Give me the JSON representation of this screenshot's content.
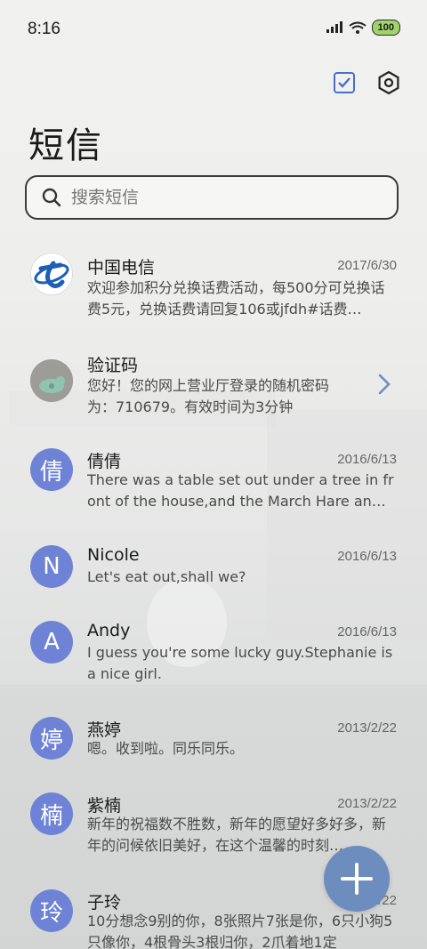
{
  "status_bar": {
    "time": "8:16",
    "battery": "100"
  },
  "header": {
    "title": "短信",
    "select_icon": "checkbox-icon",
    "settings_icon": "settings-icon"
  },
  "search": {
    "placeholder": "搜索短信"
  },
  "conversations": [
    {
      "name": "中国电信",
      "date": "2017/6/30",
      "preview": "欢迎参加积分兑换话费活动，每500分可兑换话费5元，兑换话费请回复106或jfdh#话费…",
      "avatar_type": "logo"
    },
    {
      "name": "验证码",
      "date": "",
      "preview": "您好！您的网上营业厅登录的随机密码为：710679。有效时间为3分钟",
      "avatar_type": "photo"
    },
    {
      "name": "倩倩",
      "date": "2016/6/13",
      "preview": "There was a table set out under a tree in front of the house,and the March Hare an…",
      "avatar_letter": "倩"
    },
    {
      "name": "Nicole",
      "date": "2016/6/13",
      "preview": "Let's eat out,shall we?",
      "avatar_letter": "N"
    },
    {
      "name": "Andy",
      "date": "2016/6/13",
      "preview": "I guess you're some lucky guy.Stephanie is a nice girl.",
      "avatar_letter": "A"
    },
    {
      "name": "燕婷",
      "date": "2013/2/22",
      "preview": "嗯。收到啦。同乐同乐。",
      "avatar_letter": "婷"
    },
    {
      "name": "紫楠",
      "date": "2013/2/22",
      "preview": "新年的祝福数不胜数，新年的愿望好多好多，新年的问候依旧美好，在这个温馨的时刻…",
      "avatar_letter": "楠"
    },
    {
      "name": "子玲",
      "date": "2013/2/22",
      "preview": "10分想念9别的你，8张照片7张是你，6只小狗5只像你，4根骨头3根归你，2爪着地1定",
      "avatar_letter": "玲"
    }
  ],
  "fab": {
    "icon": "plus-icon"
  },
  "colors": {
    "avatar": "#6f83d6",
    "fab": "#6d8dbf",
    "accent": "#4a6fc9"
  }
}
